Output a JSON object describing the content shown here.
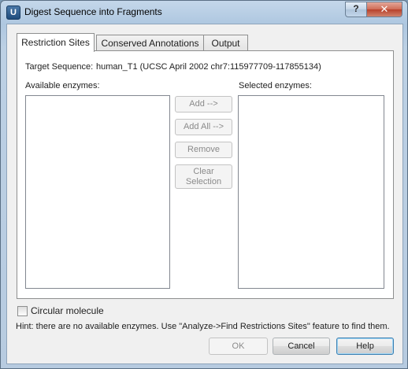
{
  "window": {
    "title": "Digest Sequence into Fragments",
    "app_icon_letter": "U",
    "help_glyph": "?",
    "close_glyph": "✕"
  },
  "tabs": [
    "Restriction Sites",
    "Conserved Annotations",
    "Output"
  ],
  "active_tab": "Restriction Sites",
  "target": {
    "label": "Target Sequence:",
    "value": "human_T1 (UCSC April 2002 chr7:115977709-117855134)"
  },
  "available_label": "Available enzymes:",
  "selected_label": "Selected enzymes:",
  "available_enzymes": [],
  "selected_enzymes": [],
  "actions": {
    "add": "Add -->",
    "add_all": "Add All -->",
    "remove": "Remove",
    "clear_line1": "Clear",
    "clear_line2": "Selection"
  },
  "circular": {
    "label": "Circular molecule",
    "checked": false
  },
  "hint": "Hint: there are no available enzymes. Use \"Analyze->Find Restrictions Sites\" feature to find them.",
  "footer": {
    "ok": "OK",
    "cancel": "Cancel",
    "help": "Help"
  }
}
